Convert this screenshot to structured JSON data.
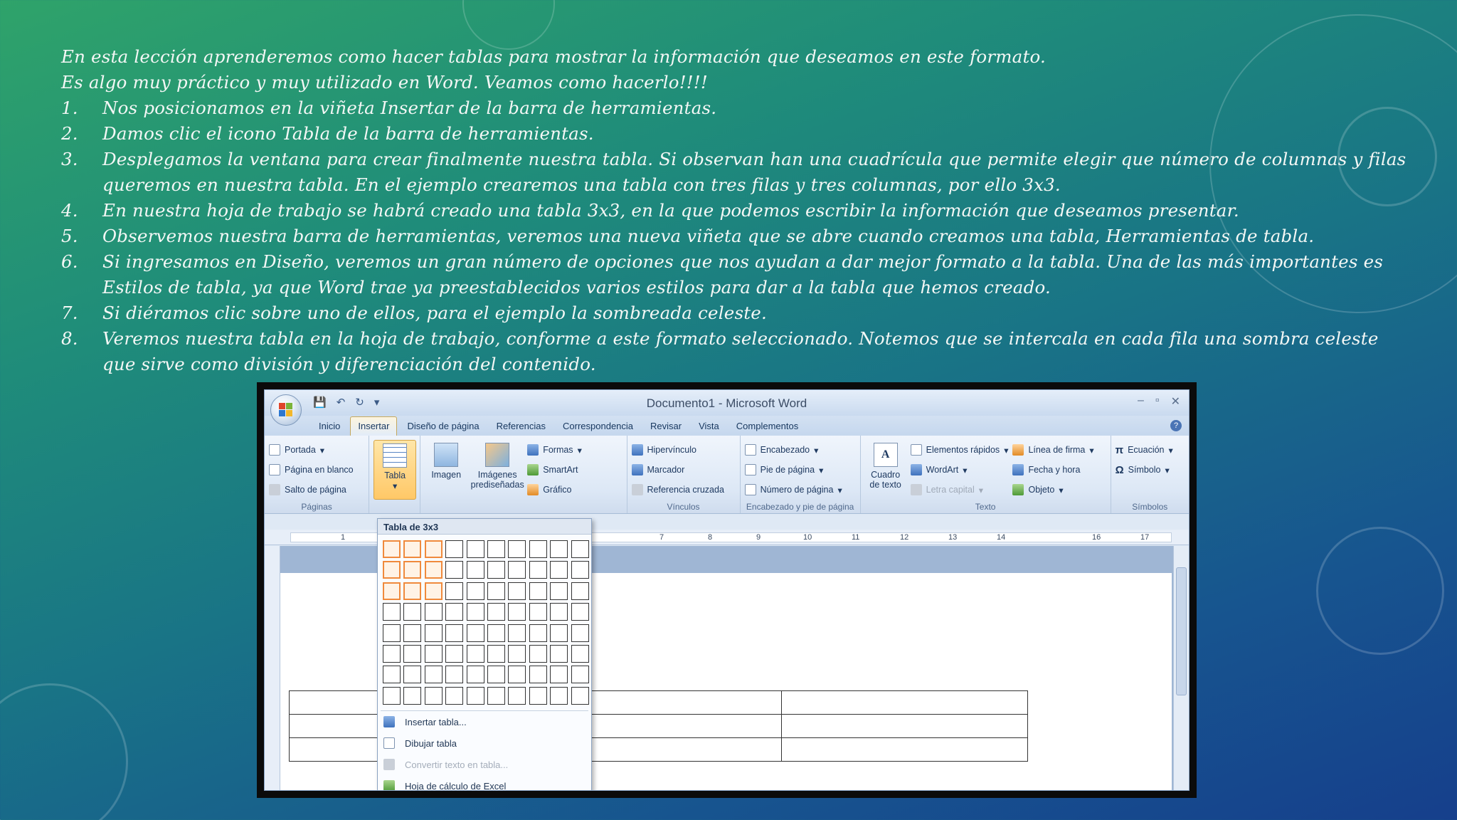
{
  "lesson": {
    "intro": [
      "En esta lección aprenderemos como hacer tablas para mostrar la información que deseamos en este formato.",
      "Es algo muy práctico y muy utilizado en Word. Veamos como hacerlo!!!!"
    ],
    "steps": [
      {
        "num": "1.",
        "text": "Nos posicionamos en la viñeta Insertar de la barra de herramientas."
      },
      {
        "num": "2.",
        "text": "Damos clic el icono Tabla de la barra de herramientas."
      },
      {
        "num": "3.",
        "text": "Desplegamos la ventana para crear finalmente nuestra tabla. Si observan han una cuadrícula que permite elegir que número de columnas y filas queremos en nuestra tabla. En el ejemplo crearemos una tabla con tres filas y tres columnas, por ello 3x3."
      },
      {
        "num": "4.",
        "text": "En nuestra hoja de trabajo se habrá creado una tabla 3x3, en la que podemos escribir la información que deseamos presentar."
      },
      {
        "num": "5.",
        "text": "Observemos nuestra barra de herramientas, veremos una nueva viñeta que se abre cuando creamos una tabla, Herramientas de tabla."
      },
      {
        "num": "6.",
        "text": "Si ingresamos en Diseño, veremos un gran número de opciones que nos ayudan a dar mejor formato a la tabla. Una de las más importantes es Estilos de tabla, ya que Word trae ya preestablecidos varios estilos para dar a la tabla que hemos creado."
      },
      {
        "num": "7.",
        "text": "Si diéramos clic sobre uno de ellos, para el ejemplo la sombreada celeste."
      },
      {
        "num": "8.",
        "text": "Veremos nuestra tabla en la hoja de trabajo, conforme a este formato seleccionado. Notemos que se intercala en cada fila una sombra celeste que sirve como división y diferenciación del contenido."
      }
    ]
  },
  "word": {
    "title": "Documento1 - Microsoft Word",
    "tabs": [
      "Inicio",
      "Insertar",
      "Diseño de página",
      "Referencias",
      "Correspondencia",
      "Revisar",
      "Vista",
      "Complementos"
    ],
    "active_tab": "Insertar",
    "groups": {
      "paginas": {
        "label": "Páginas",
        "items": [
          "Portada",
          "Página en blanco",
          "Salto de página"
        ]
      },
      "tablas": {
        "button": "Tabla"
      },
      "ilustraciones": {
        "imagen": "Imagen",
        "imagenes": "Imágenes prediseñadas",
        "small": [
          "Formas",
          "SmartArt",
          "Gráfico"
        ]
      },
      "vinculos": {
        "label": "Vínculos",
        "items": [
          "Hipervínculo",
          "Marcador",
          "Referencia cruzada"
        ]
      },
      "encabezado": {
        "label": "Encabezado y pie de página",
        "items": [
          "Encabezado",
          "Pie de página",
          "Número de página"
        ]
      },
      "texto": {
        "label": "Texto",
        "cuadro": "Cuadro de texto",
        "col1": [
          "Elementos rápidos",
          "WordArt",
          "Letra capital"
        ],
        "col2": [
          "Línea de firma",
          "Fecha y hora",
          "Objeto"
        ]
      },
      "simbolos": {
        "label": "Símbolos",
        "items": [
          "Ecuación",
          "Símbolo"
        ]
      }
    },
    "ruler_numbers": [
      "1",
      "7",
      "8",
      "9",
      "10",
      "11",
      "12",
      "13",
      "14",
      "16",
      "17"
    ],
    "dropdown": {
      "title": "Tabla de 3x3",
      "selected_rows": 3,
      "selected_cols": 3,
      "grid_rows": 8,
      "grid_cols": 10,
      "items": [
        {
          "label": "Insertar tabla...",
          "disabled": false
        },
        {
          "label": "Dibujar tabla",
          "disabled": false
        },
        {
          "label": "Convertir texto en tabla...",
          "disabled": true
        },
        {
          "label": "Hoja de cálculo de Excel",
          "disabled": false
        }
      ]
    }
  },
  "colors": {
    "highlight": "#f08a3c",
    "ribbon_active": "#ffc867"
  }
}
